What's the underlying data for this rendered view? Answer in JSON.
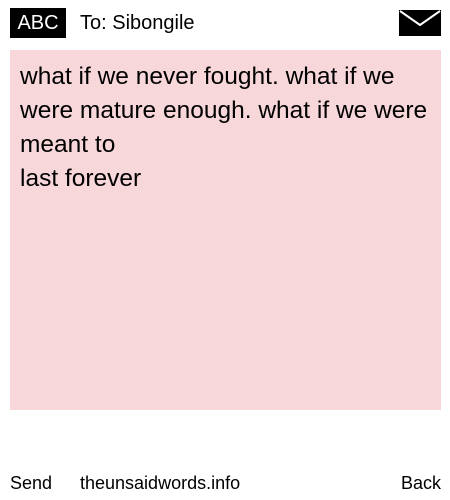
{
  "header": {
    "input_mode": "ABC",
    "recipient": "To: Sibongile",
    "envelope_icon": "envelope-icon"
  },
  "message": {
    "text": "what if we never fought. what if we were mature enough. what if we were meant to\nlast forever",
    "background_color": "#f8d7da"
  },
  "footer": {
    "send_label": "Send",
    "site_label": "theunsaidwords.info",
    "back_label": "Back"
  }
}
